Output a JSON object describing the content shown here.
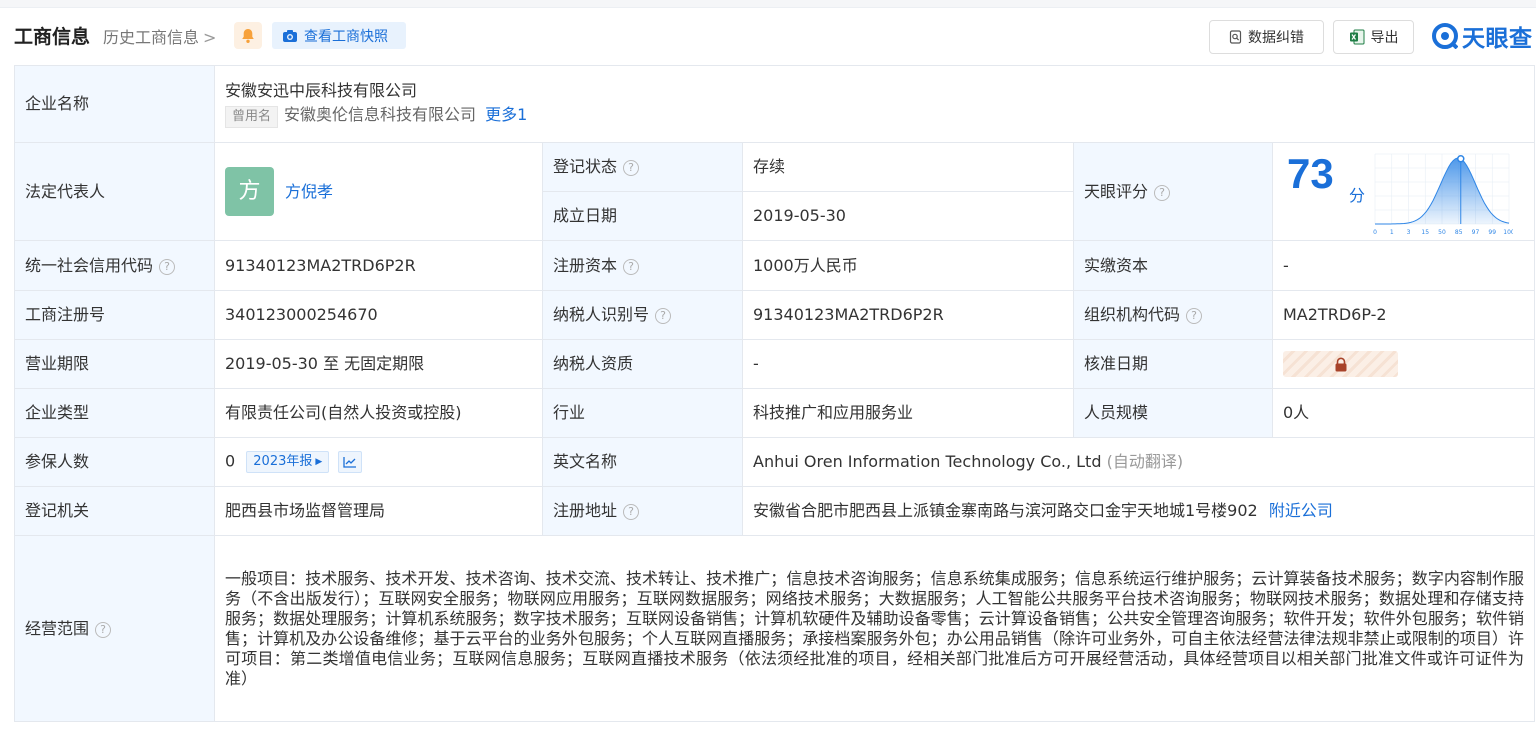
{
  "header": {
    "title": "工商信息",
    "history_label": "历史工商信息",
    "history_chevron": ">",
    "snapshot_label": "查看工商快照",
    "correct_label": "数据纠错",
    "export_label": "导出",
    "logo_text": "天眼查",
    "icons": [
      "bell-icon",
      "camera-icon",
      "correct-icon",
      "excel-icon",
      "logo-icon"
    ],
    "colors": {
      "brand": "#1a6fd8",
      "label_bg": "#f2f8ff",
      "status_green": "#1b9a4a",
      "bell": "#f7a13a"
    }
  },
  "labels": {
    "company_name": "企业名称",
    "legal_rep": "法定代表人",
    "reg_status": "登记状态",
    "established": "成立日期",
    "tianyan_score": "天眼评分",
    "credit_code": "统一社会信用代码",
    "reg_capital": "注册资本",
    "paid_capital": "实缴资本",
    "reg_number": "工商注册号",
    "taxpayer_id": "纳税人识别号",
    "org_code": "组织机构代码",
    "term": "营业期限",
    "taxpayer_qual": "纳税人资质",
    "approval_date": "核准日期",
    "company_type": "企业类型",
    "industry": "行业",
    "staff_size": "人员规模",
    "insured": "参保人数",
    "english_name": "英文名称",
    "reg_authority": "登记机关",
    "reg_address": "注册地址",
    "scope": "经营范围"
  },
  "values": {
    "company_name": "安徽安迅中辰科技有限公司",
    "former_tag": "曾用名",
    "former_name": "安徽奥伦信息科技有限公司",
    "former_more": "更多1",
    "legal_rep_avatar": "方",
    "legal_rep_name": "方倪孝",
    "reg_status": "存续",
    "established": "2019-05-30",
    "score": "73",
    "score_unit": "分",
    "credit_code": "91340123MA2TRD6P2R",
    "reg_capital": "1000万人民币",
    "paid_capital": "-",
    "reg_number": "340123000254670",
    "taxpayer_id": "91340123MA2TRD6P2R",
    "org_code": "MA2TRD6P-2",
    "term": "2019-05-30 至 无固定期限",
    "taxpayer_qual": "-",
    "company_type": "有限责任公司(自然人投资或控股)",
    "industry": "科技推广和应用服务业",
    "staff_size": "0人",
    "insured": "0",
    "report_year": "2023年报",
    "english_name": "Anhui Oren Information Technology Co., Ltd",
    "auto_translate": "(自动翻译)",
    "reg_authority": "肥西县市场监督管理局",
    "reg_address": "安徽省合肥市肥西县上派镇金寨南路与滨河路交口金宇天地城1号楼902",
    "nearby": "附近公司",
    "scope": "一般项目：技术服务、技术开发、技术咨询、技术交流、技术转让、技术推广；信息技术咨询服务；信息系统集成服务；信息系统运行维护服务；云计算装备技术服务；数字内容制作服务（不含出版发行）；互联网安全服务；物联网应用服务；互联网数据服务；网络技术服务；大数据服务；人工智能公共服务平台技术咨询服务；物联网技术服务；数据处理和存储支持服务；数据处理服务；计算机系统服务；数字技术服务；互联网设备销售；计算机软硬件及辅助设备零售；云计算设备销售；公共安全管理咨询服务；软件开发；软件外包服务；软件销售；计算机及办公设备维修；基于云平台的业务外包服务；个人互联网直播服务；承接档案服务外包；办公用品销售（除许可业务外，可自主依法经营法律法规非禁止或限制的项目）许可项目：第二类增值电信业务；互联网信息服务；互联网直播技术服务（依法须经批准的项目，经相关部门批准后方可开展经营活动，具体经营项目以相关部门批准文件或许可证件为准）"
  },
  "score_chart": {
    "type": "area",
    "x_ticks": [
      "0",
      "1",
      "3",
      "15",
      "50",
      "85",
      "97",
      "99",
      "100"
    ],
    "marker_value": 73
  }
}
